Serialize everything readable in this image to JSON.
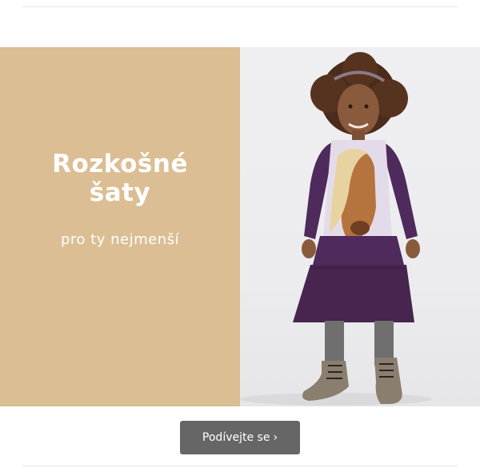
{
  "promo": {
    "title_line1": "Rozkošné",
    "title_line2": "šaty",
    "subtitle": "pro ty nejmenší"
  },
  "cta": {
    "label": "Podívejte se",
    "icon": "chevron-right-icon"
  },
  "colors": {
    "promo_background": "#dbbe93",
    "button_background": "#666666",
    "dress": "#4f2a5c"
  }
}
